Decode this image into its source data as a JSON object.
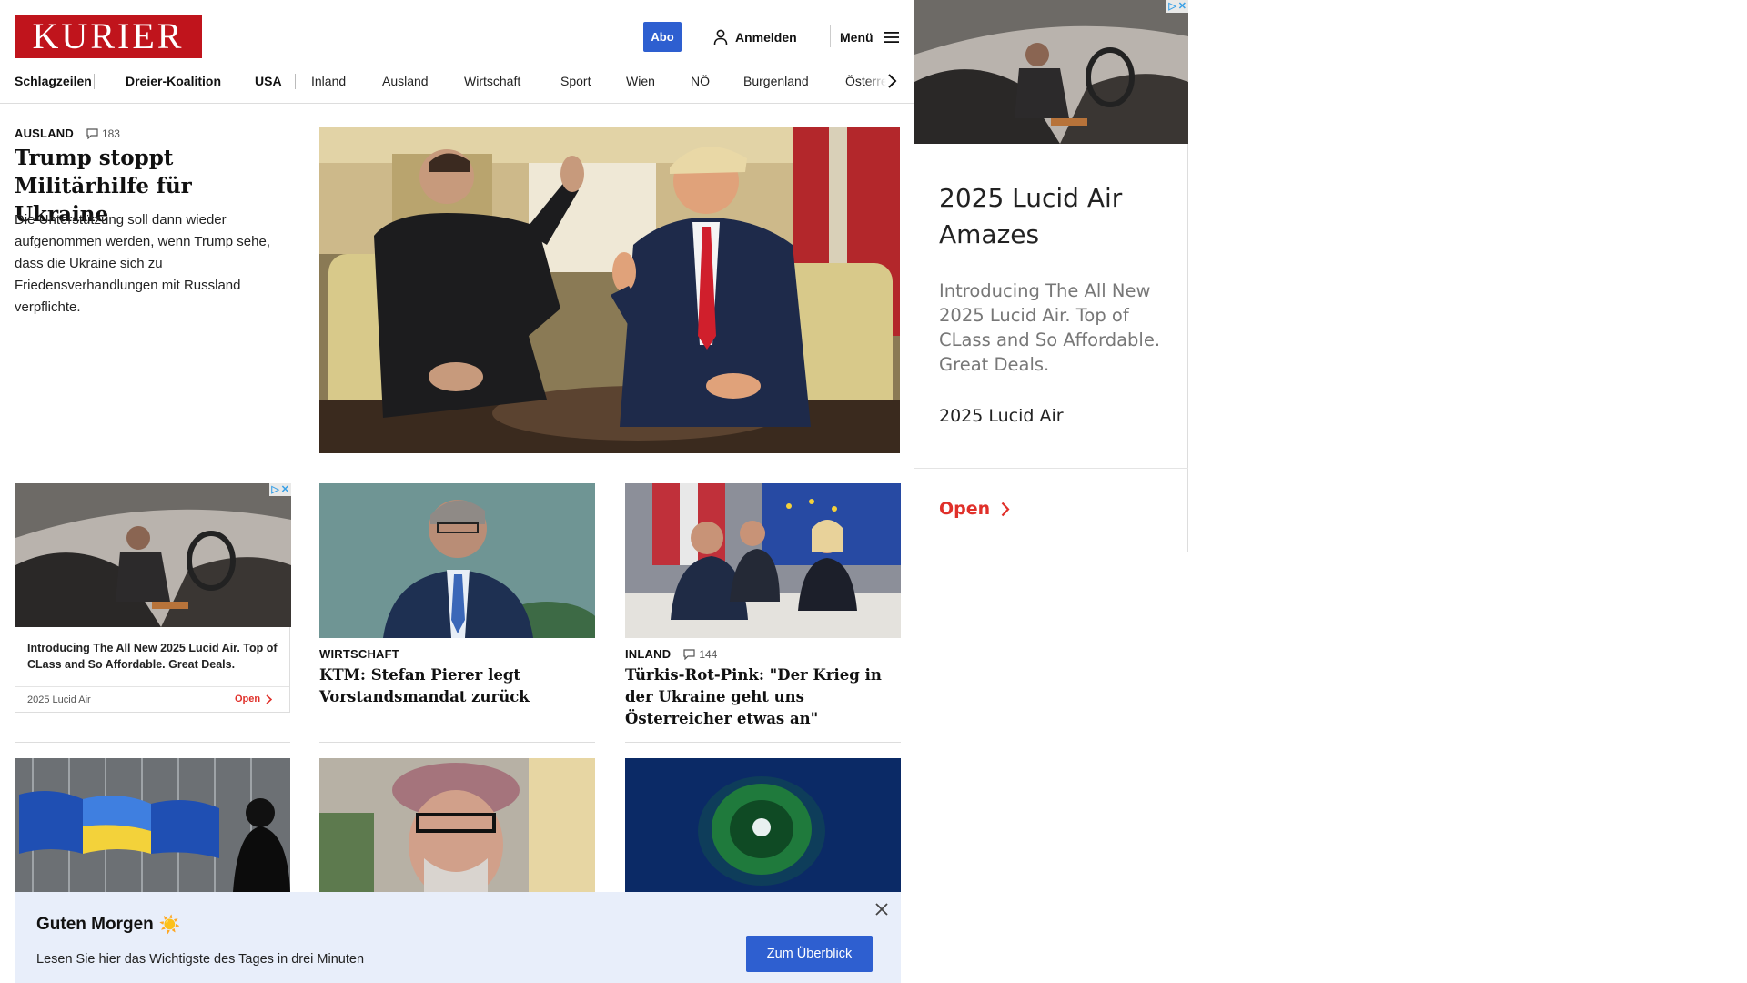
{
  "header": {
    "logo": "KURIER",
    "abo_label": "Abo",
    "login_label": "Anmelden",
    "menu_label": "Menü",
    "nav": [
      "Schlagzeilen",
      "Dreier-Koalition",
      "USA",
      "Inland",
      "Ausland",
      "Wirtschaft",
      "Sport",
      "Wien",
      "NÖ",
      "Burgenland",
      "Österreich"
    ]
  },
  "lead": {
    "kicker": "AUSLAND",
    "comments": "183",
    "title": "Trump stoppt Militärhilfe für Ukraine",
    "teaser": "Die Unterstützung soll dann wieder aufgenommen werden, wenn Trump sehe, dass die Ukraine sich zu Friedensverhandlungen mit Russland verpflichte."
  },
  "cards": [
    {
      "kicker": "WIRTSCHAFT",
      "comments": "",
      "title": "KTM: Stefan Pierer legt Vorstandsmandat zurück"
    },
    {
      "kicker": "INLAND",
      "comments": "144",
      "title": "Türkis-Rot-Pink: \"Der Krieg in der Ukraine geht uns Österreicher etwas an\""
    }
  ],
  "ad_small": {
    "text": "Introducing The All New 2025 Lucid Air. Top of CLass and So Affordable. Great Deals.",
    "brand": "2025 Lucid Air",
    "open_label": "Open"
  },
  "ad_right": {
    "title": "2025 Lucid Air Amazes",
    "body": "Introducing The All New 2025 Lucid Air. Top of CLass and So Affordable. Great Deals.",
    "brand": "2025 Lucid Air",
    "open_label": "Open"
  },
  "banner": {
    "title": "Guten Morgen",
    "emoji": "☀️",
    "text": "Lesen Sie hier das Wichtigste des Tages in drei Minuten",
    "button_label": "Zum Überblick"
  },
  "colors": {
    "brand_red": "#c0141c",
    "accent_blue": "#2e5fd0",
    "ad_red": "#e0302a",
    "banner_bg": "#e8eefa"
  }
}
